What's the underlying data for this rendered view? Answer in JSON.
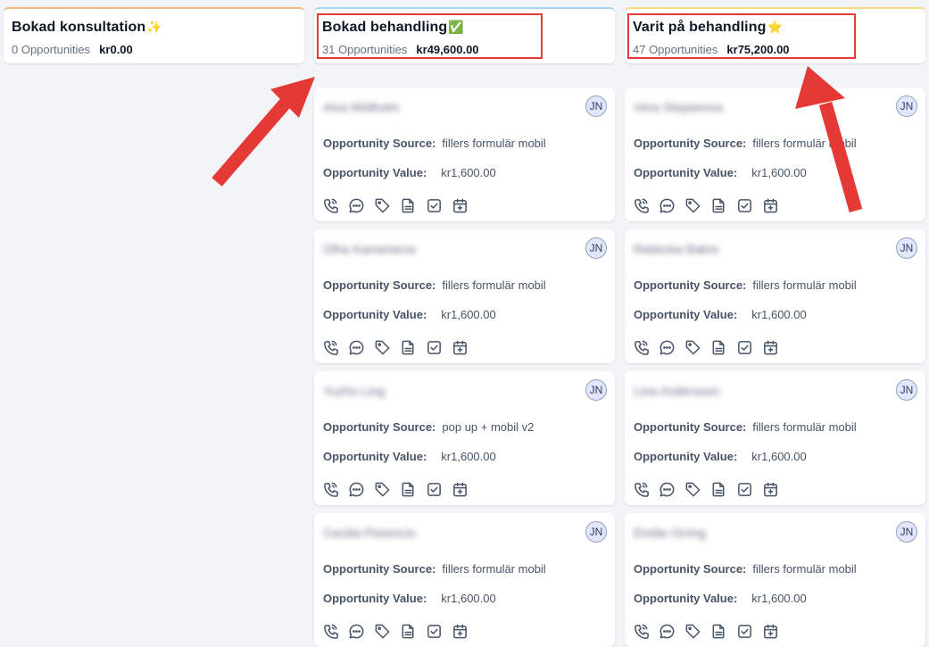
{
  "columns": [
    {
      "title": "Bokad konsultation",
      "emoji": "✨",
      "count": "0 Opportunities",
      "value": "kr0.00",
      "accent": "#f4b87a"
    },
    {
      "title": "Bokad behandling",
      "emoji": "✅",
      "count": "31 Opportunities",
      "value": "kr49,600.00",
      "accent": "#a9d4f5"
    },
    {
      "title": "Varit på behandling",
      "emoji": "⭐",
      "count": "47 Opportunities",
      "value": "kr75,200.00",
      "accent": "#f5dc7a"
    }
  ],
  "labels": {
    "source": "Opportunity Source:",
    "value": "Opportunity Value:"
  },
  "cards_col2": [
    {
      "name": "Alva Widholm",
      "avatar": "JN",
      "source": "fillers formulär mobil",
      "value": "kr1,600.00"
    },
    {
      "name": "Olha Kamenieva",
      "avatar": "JN",
      "source": "fillers formulär mobil",
      "value": "kr1,600.00"
    },
    {
      "name": "Yuzhu Ling",
      "avatar": "JN",
      "source": "pop up + mobil v2",
      "value": "kr1,600.00"
    },
    {
      "name": "Cecilia Florencio",
      "avatar": "JN",
      "source": "fillers formulär mobil",
      "value": "kr1,600.00"
    }
  ],
  "cards_col3": [
    {
      "name": "Vera Stepanova",
      "avatar": "JN",
      "source": "fillers formulär mobil",
      "value": "kr1,600.00"
    },
    {
      "name": "Rebecka Bakre",
      "avatar": "JN",
      "source": "fillers formulär mobil",
      "value": "kr1,600.00"
    },
    {
      "name": "Lina Andersson",
      "avatar": "JN",
      "source": "fillers formulär mobil",
      "value": "kr1,600.00"
    },
    {
      "name": "Emilie Orring",
      "avatar": "JN",
      "source": "fillers formulär mobil",
      "value": "kr1,600.00"
    }
  ],
  "action_icons": [
    "phone-icon",
    "chat-icon",
    "tag-icon",
    "note-icon",
    "task-check-icon",
    "calendar-add-icon"
  ],
  "annotation_color": "#e53935"
}
